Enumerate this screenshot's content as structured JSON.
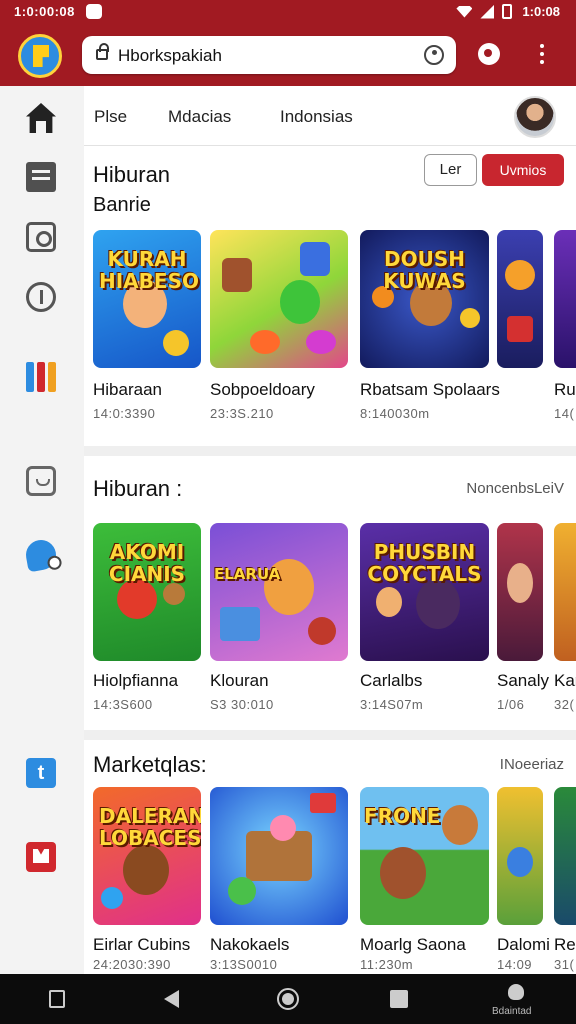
{
  "status_bar": {
    "time_left": "1:0:00:08",
    "time_right": "1:0:08"
  },
  "app_bar": {
    "url": "Hborkspakiah",
    "logo_icon": "app-logo-icon",
    "search_icon": "search-icon",
    "menu_icon": "more-vert-icon",
    "accent_color": "#a11a22"
  },
  "sidebar": {
    "items": [
      {
        "icon": "home-icon"
      },
      {
        "icon": "message-icon"
      },
      {
        "icon": "camera-icon"
      },
      {
        "icon": "info-icon"
      },
      {
        "icon": "apps-grid-icon"
      },
      {
        "icon": "bag-icon"
      },
      {
        "icon": "chat-icon"
      },
      {
        "icon": "t-app-icon",
        "glyph": "t"
      },
      {
        "icon": "m-app-icon"
      }
    ]
  },
  "tabs": [
    "Plse",
    "Mdacias",
    "Indonsias"
  ],
  "sections": [
    {
      "title": "Hiburan",
      "subtitle": "Banrie",
      "button_outline": "Ler",
      "button_primary": "Uvmios",
      "cards": [
        {
          "thumb_text": "KURAH HIABESO",
          "title": "Hibaraan",
          "meta": "14:0:3390"
        },
        {
          "thumb_text": "",
          "title": "Sobpoeldoary",
          "meta": "23:3S.210"
        },
        {
          "thumb_text": "DOUSH KUWAS",
          "title": "Rbatsam Spolaars",
          "meta": "8:140030m"
        },
        {
          "thumb_text": "",
          "title": "",
          "meta": ""
        },
        {
          "thumb_text": "",
          "title": "Ru",
          "meta": "14("
        }
      ]
    },
    {
      "title": "Hiburan :",
      "link": "NoncenbsLeiV",
      "cards": [
        {
          "thumb_text": "AKOMI CIANIS",
          "title": "Hiolpfianna",
          "meta": "14:3S600"
        },
        {
          "thumb_text": "ELARUA",
          "title": "Klouran",
          "meta": "S3 30:010"
        },
        {
          "thumb_text": "PHUSBIN COYCTALS",
          "title": "Carlalbs",
          "meta": "3:14S07m"
        },
        {
          "thumb_text": "",
          "title": "Sanaly",
          "meta": "1/06"
        },
        {
          "thumb_text": "",
          "title": "Kar",
          "meta": "32("
        }
      ]
    },
    {
      "title": "Marketqlas:",
      "link": "INoeeriaz",
      "cards": [
        {
          "thumb_text": "DALERAN LOBACES",
          "title": "Eirlar Cubins",
          "meta": "24:2030:390"
        },
        {
          "thumb_text": "",
          "title": "Nakokaels",
          "meta": "3:13S0010"
        },
        {
          "thumb_text": "FRONE",
          "title": "Moarlg Saona",
          "meta": "11:230m"
        },
        {
          "thumb_text": "",
          "title": "Dalomi",
          "meta": "14:09"
        },
        {
          "thumb_text": "",
          "title": "Re",
          "meta": "31("
        }
      ]
    }
  ],
  "nav_bar": {
    "assistant_label": "Bdaintad"
  }
}
